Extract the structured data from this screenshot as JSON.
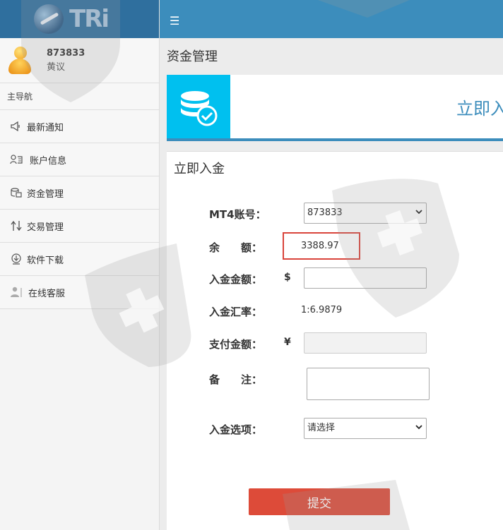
{
  "brand": {
    "logo_text": "TRi"
  },
  "user": {
    "id": "873833",
    "name": "黄议"
  },
  "sidebar": {
    "caption": "主导航",
    "items": [
      {
        "label": "最新通知",
        "icon": "megaphone-icon"
      },
      {
        "label": "账户信息",
        "icon": "user-card-icon"
      },
      {
        "label": "资金管理",
        "icon": "funds-icon"
      },
      {
        "label": "交易管理",
        "icon": "trade-icon"
      },
      {
        "label": "软件下载",
        "icon": "download-icon"
      },
      {
        "label": "在线客服",
        "icon": "support-icon"
      }
    ]
  },
  "topbar": {
    "menu_icon": "hamburger-icon"
  },
  "page": {
    "title": "资金管理",
    "banner_title": "立即入金",
    "form_heading": "立即入金"
  },
  "form": {
    "mt4_label": "MT4账号：",
    "mt4_value": "873833",
    "balance_label": "余　　额：",
    "balance_value": "3388.97",
    "deposit_label": "入金金额：",
    "deposit_symbol": "$",
    "deposit_value": "",
    "rate_label": "入金汇率：",
    "rate_value": "1:6.9879",
    "pay_label": "支付金额：",
    "pay_symbol": "¥",
    "pay_value": "",
    "remark_label": "备　　注：",
    "option_label": "入金选项：",
    "option_value": "请选择",
    "submit_label": "提交"
  },
  "colors": {
    "topbar": "#3c8dbc",
    "logo_bar": "#2f6f9e",
    "banner_icon": "#00c0ef",
    "submit": "#dd4b39",
    "highlight": "#d9443b"
  }
}
